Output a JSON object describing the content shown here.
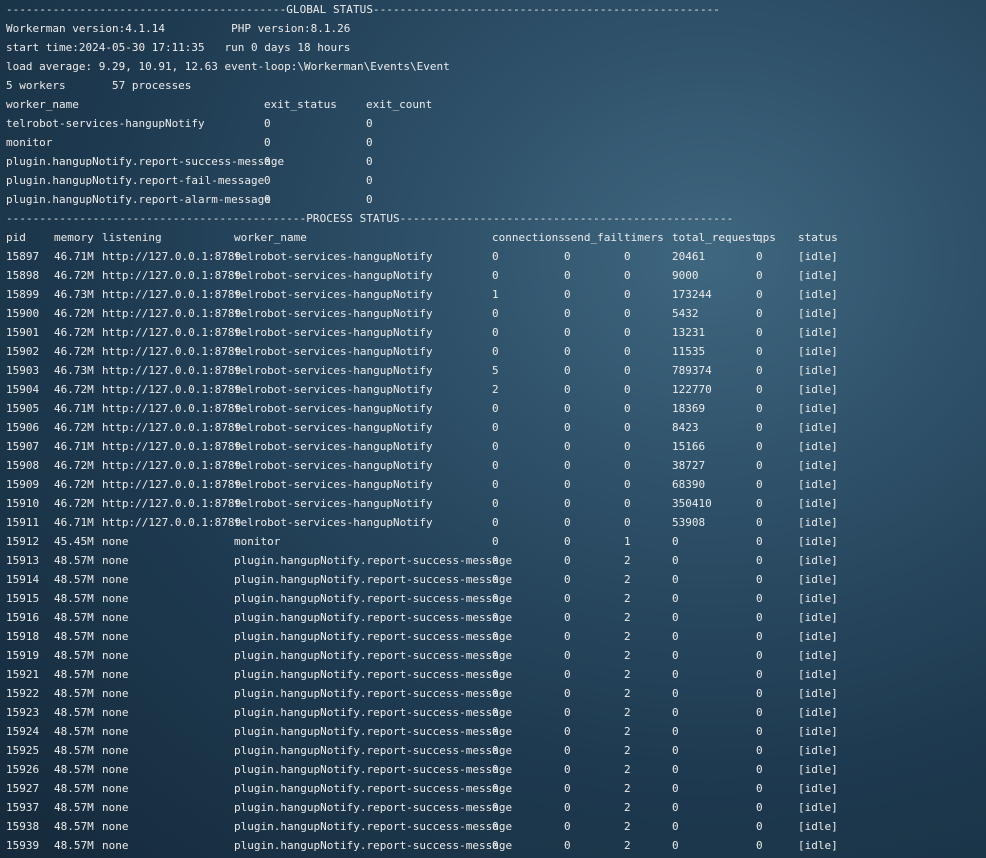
{
  "global": {
    "header": "------------------------------------------GLOBAL STATUS----------------------------------------------------",
    "version_line": "Workerman version:4.1.14          PHP version:8.1.26",
    "start_line": "start time:2024-05-30 17:11:35   run 0 days 18 hours",
    "load_line": "load average: 9.29, 10.91, 12.63 event-loop:\\Workerman\\Events\\Event",
    "workers_line": "5 workers       57 processes",
    "columns": [
      "worker_name",
      "exit_status",
      "exit_count"
    ],
    "rows": [
      {
        "name": "telrobot-services-hangupNotify",
        "exit_status": "0",
        "exit_count": "0"
      },
      {
        "name": "monitor",
        "exit_status": "0",
        "exit_count": "0"
      },
      {
        "name": "plugin.hangupNotify.report-success-message",
        "exit_status": "0",
        "exit_count": "0"
      },
      {
        "name": "plugin.hangupNotify.report-fail-message",
        "exit_status": "0",
        "exit_count": "0"
      },
      {
        "name": "plugin.hangupNotify.report-alarm-message",
        "exit_status": "0",
        "exit_count": "0"
      }
    ]
  },
  "process": {
    "header": "---------------------------------------------PROCESS STATUS--------------------------------------------------",
    "columns": [
      "pid",
      "memory",
      "listening",
      "worker_name",
      "connections",
      "send_fail",
      "timers",
      "total_request",
      "qps",
      "status"
    ],
    "rows": [
      [
        "15897",
        "46.71M",
        "http://127.0.0.1:8789",
        "telrobot-services-hangupNotify",
        "0",
        "0",
        "0",
        "20461",
        "0",
        "[idle]"
      ],
      [
        "15898",
        "46.72M",
        "http://127.0.0.1:8789",
        "telrobot-services-hangupNotify",
        "0",
        "0",
        "0",
        "9000",
        "0",
        "[idle]"
      ],
      [
        "15899",
        "46.73M",
        "http://127.0.0.1:8789",
        "telrobot-services-hangupNotify",
        "1",
        "0",
        "0",
        "173244",
        "0",
        "[idle]"
      ],
      [
        "15900",
        "46.72M",
        "http://127.0.0.1:8789",
        "telrobot-services-hangupNotify",
        "0",
        "0",
        "0",
        "5432",
        "0",
        "[idle]"
      ],
      [
        "15901",
        "46.72M",
        "http://127.0.0.1:8789",
        "telrobot-services-hangupNotify",
        "0",
        "0",
        "0",
        "13231",
        "0",
        "[idle]"
      ],
      [
        "15902",
        "46.72M",
        "http://127.0.0.1:8789",
        "telrobot-services-hangupNotify",
        "0",
        "0",
        "0",
        "11535",
        "0",
        "[idle]"
      ],
      [
        "15903",
        "46.73M",
        "http://127.0.0.1:8789",
        "telrobot-services-hangupNotify",
        "5",
        "0",
        "0",
        "789374",
        "0",
        "[idle]"
      ],
      [
        "15904",
        "46.72M",
        "http://127.0.0.1:8789",
        "telrobot-services-hangupNotify",
        "2",
        "0",
        "0",
        "122770",
        "0",
        "[idle]"
      ],
      [
        "15905",
        "46.71M",
        "http://127.0.0.1:8789",
        "telrobot-services-hangupNotify",
        "0",
        "0",
        "0",
        "18369",
        "0",
        "[idle]"
      ],
      [
        "15906",
        "46.72M",
        "http://127.0.0.1:8789",
        "telrobot-services-hangupNotify",
        "0",
        "0",
        "0",
        "8423",
        "0",
        "[idle]"
      ],
      [
        "15907",
        "46.71M",
        "http://127.0.0.1:8789",
        "telrobot-services-hangupNotify",
        "0",
        "0",
        "0",
        "15166",
        "0",
        "[idle]"
      ],
      [
        "15908",
        "46.72M",
        "http://127.0.0.1:8789",
        "telrobot-services-hangupNotify",
        "0",
        "0",
        "0",
        "38727",
        "0",
        "[idle]"
      ],
      [
        "15909",
        "46.72M",
        "http://127.0.0.1:8789",
        "telrobot-services-hangupNotify",
        "0",
        "0",
        "0",
        "68390",
        "0",
        "[idle]"
      ],
      [
        "15910",
        "46.72M",
        "http://127.0.0.1:8789",
        "telrobot-services-hangupNotify",
        "0",
        "0",
        "0",
        "350410",
        "0",
        "[idle]"
      ],
      [
        "15911",
        "46.71M",
        "http://127.0.0.1:8789",
        "telrobot-services-hangupNotify",
        "0",
        "0",
        "0",
        "53908",
        "0",
        "[idle]"
      ],
      [
        "15912",
        "45.45M",
        "none",
        "monitor",
        "0",
        "0",
        "1",
        "0",
        "0",
        "[idle]"
      ],
      [
        "15913",
        "48.57M",
        "none",
        "plugin.hangupNotify.report-success-message",
        "0",
        "0",
        "2",
        "0",
        "0",
        "[idle]"
      ],
      [
        "15914",
        "48.57M",
        "none",
        "plugin.hangupNotify.report-success-message",
        "0",
        "0",
        "2",
        "0",
        "0",
        "[idle]"
      ],
      [
        "15915",
        "48.57M",
        "none",
        "plugin.hangupNotify.report-success-message",
        "0",
        "0",
        "2",
        "0",
        "0",
        "[idle]"
      ],
      [
        "15916",
        "48.57M",
        "none",
        "plugin.hangupNotify.report-success-message",
        "0",
        "0",
        "2",
        "0",
        "0",
        "[idle]"
      ],
      [
        "15918",
        "48.57M",
        "none",
        "plugin.hangupNotify.report-success-message",
        "0",
        "0",
        "2",
        "0",
        "0",
        "[idle]"
      ],
      [
        "15919",
        "48.57M",
        "none",
        "plugin.hangupNotify.report-success-message",
        "0",
        "0",
        "2",
        "0",
        "0",
        "[idle]"
      ],
      [
        "15921",
        "48.57M",
        "none",
        "plugin.hangupNotify.report-success-message",
        "0",
        "0",
        "2",
        "0",
        "0",
        "[idle]"
      ],
      [
        "15922",
        "48.57M",
        "none",
        "plugin.hangupNotify.report-success-message",
        "0",
        "0",
        "2",
        "0",
        "0",
        "[idle]"
      ],
      [
        "15923",
        "48.57M",
        "none",
        "plugin.hangupNotify.report-success-message",
        "0",
        "0",
        "2",
        "0",
        "0",
        "[idle]"
      ],
      [
        "15924",
        "48.57M",
        "none",
        "plugin.hangupNotify.report-success-message",
        "0",
        "0",
        "2",
        "0",
        "0",
        "[idle]"
      ],
      [
        "15925",
        "48.57M",
        "none",
        "plugin.hangupNotify.report-success-message",
        "0",
        "0",
        "2",
        "0",
        "0",
        "[idle]"
      ],
      [
        "15926",
        "48.57M",
        "none",
        "plugin.hangupNotify.report-success-message",
        "0",
        "0",
        "2",
        "0",
        "0",
        "[idle]"
      ],
      [
        "15927",
        "48.57M",
        "none",
        "plugin.hangupNotify.report-success-message",
        "0",
        "0",
        "2",
        "0",
        "0",
        "[idle]"
      ],
      [
        "15937",
        "48.57M",
        "none",
        "plugin.hangupNotify.report-success-message",
        "0",
        "0",
        "2",
        "0",
        "0",
        "[idle]"
      ],
      [
        "15938",
        "48.57M",
        "none",
        "plugin.hangupNotify.report-success-message",
        "0",
        "0",
        "2",
        "0",
        "0",
        "[idle]"
      ],
      [
        "15939",
        "48.57M",
        "none",
        "plugin.hangupNotify.report-success-message",
        "0",
        "0",
        "2",
        "0",
        "0",
        "[idle]"
      ]
    ]
  }
}
